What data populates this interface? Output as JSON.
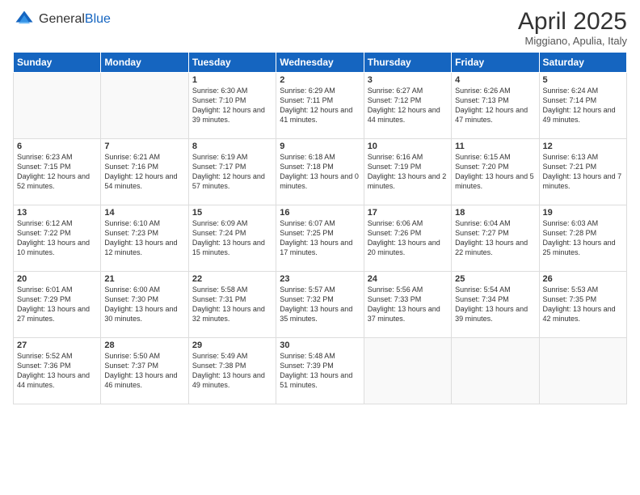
{
  "header": {
    "logo": {
      "general": "General",
      "blue": "Blue"
    },
    "title": "April 2025",
    "location": "Miggiano, Apulia, Italy"
  },
  "weekdays": [
    "Sunday",
    "Monday",
    "Tuesday",
    "Wednesday",
    "Thursday",
    "Friday",
    "Saturday"
  ],
  "weeks": [
    [
      {
        "day": "",
        "info": ""
      },
      {
        "day": "",
        "info": ""
      },
      {
        "day": "1",
        "info": "Sunrise: 6:30 AM\nSunset: 7:10 PM\nDaylight: 12 hours and 39 minutes."
      },
      {
        "day": "2",
        "info": "Sunrise: 6:29 AM\nSunset: 7:11 PM\nDaylight: 12 hours and 41 minutes."
      },
      {
        "day": "3",
        "info": "Sunrise: 6:27 AM\nSunset: 7:12 PM\nDaylight: 12 hours and 44 minutes."
      },
      {
        "day": "4",
        "info": "Sunrise: 6:26 AM\nSunset: 7:13 PM\nDaylight: 12 hours and 47 minutes."
      },
      {
        "day": "5",
        "info": "Sunrise: 6:24 AM\nSunset: 7:14 PM\nDaylight: 12 hours and 49 minutes."
      }
    ],
    [
      {
        "day": "6",
        "info": "Sunrise: 6:23 AM\nSunset: 7:15 PM\nDaylight: 12 hours and 52 minutes."
      },
      {
        "day": "7",
        "info": "Sunrise: 6:21 AM\nSunset: 7:16 PM\nDaylight: 12 hours and 54 minutes."
      },
      {
        "day": "8",
        "info": "Sunrise: 6:19 AM\nSunset: 7:17 PM\nDaylight: 12 hours and 57 minutes."
      },
      {
        "day": "9",
        "info": "Sunrise: 6:18 AM\nSunset: 7:18 PM\nDaylight: 13 hours and 0 minutes."
      },
      {
        "day": "10",
        "info": "Sunrise: 6:16 AM\nSunset: 7:19 PM\nDaylight: 13 hours and 2 minutes."
      },
      {
        "day": "11",
        "info": "Sunrise: 6:15 AM\nSunset: 7:20 PM\nDaylight: 13 hours and 5 minutes."
      },
      {
        "day": "12",
        "info": "Sunrise: 6:13 AM\nSunset: 7:21 PM\nDaylight: 13 hours and 7 minutes."
      }
    ],
    [
      {
        "day": "13",
        "info": "Sunrise: 6:12 AM\nSunset: 7:22 PM\nDaylight: 13 hours and 10 minutes."
      },
      {
        "day": "14",
        "info": "Sunrise: 6:10 AM\nSunset: 7:23 PM\nDaylight: 13 hours and 12 minutes."
      },
      {
        "day": "15",
        "info": "Sunrise: 6:09 AM\nSunset: 7:24 PM\nDaylight: 13 hours and 15 minutes."
      },
      {
        "day": "16",
        "info": "Sunrise: 6:07 AM\nSunset: 7:25 PM\nDaylight: 13 hours and 17 minutes."
      },
      {
        "day": "17",
        "info": "Sunrise: 6:06 AM\nSunset: 7:26 PM\nDaylight: 13 hours and 20 minutes."
      },
      {
        "day": "18",
        "info": "Sunrise: 6:04 AM\nSunset: 7:27 PM\nDaylight: 13 hours and 22 minutes."
      },
      {
        "day": "19",
        "info": "Sunrise: 6:03 AM\nSunset: 7:28 PM\nDaylight: 13 hours and 25 minutes."
      }
    ],
    [
      {
        "day": "20",
        "info": "Sunrise: 6:01 AM\nSunset: 7:29 PM\nDaylight: 13 hours and 27 minutes."
      },
      {
        "day": "21",
        "info": "Sunrise: 6:00 AM\nSunset: 7:30 PM\nDaylight: 13 hours and 30 minutes."
      },
      {
        "day": "22",
        "info": "Sunrise: 5:58 AM\nSunset: 7:31 PM\nDaylight: 13 hours and 32 minutes."
      },
      {
        "day": "23",
        "info": "Sunrise: 5:57 AM\nSunset: 7:32 PM\nDaylight: 13 hours and 35 minutes."
      },
      {
        "day": "24",
        "info": "Sunrise: 5:56 AM\nSunset: 7:33 PM\nDaylight: 13 hours and 37 minutes."
      },
      {
        "day": "25",
        "info": "Sunrise: 5:54 AM\nSunset: 7:34 PM\nDaylight: 13 hours and 39 minutes."
      },
      {
        "day": "26",
        "info": "Sunrise: 5:53 AM\nSunset: 7:35 PM\nDaylight: 13 hours and 42 minutes."
      }
    ],
    [
      {
        "day": "27",
        "info": "Sunrise: 5:52 AM\nSunset: 7:36 PM\nDaylight: 13 hours and 44 minutes."
      },
      {
        "day": "28",
        "info": "Sunrise: 5:50 AM\nSunset: 7:37 PM\nDaylight: 13 hours and 46 minutes."
      },
      {
        "day": "29",
        "info": "Sunrise: 5:49 AM\nSunset: 7:38 PM\nDaylight: 13 hours and 49 minutes."
      },
      {
        "day": "30",
        "info": "Sunrise: 5:48 AM\nSunset: 7:39 PM\nDaylight: 13 hours and 51 minutes."
      },
      {
        "day": "",
        "info": ""
      },
      {
        "day": "",
        "info": ""
      },
      {
        "day": "",
        "info": ""
      }
    ]
  ]
}
